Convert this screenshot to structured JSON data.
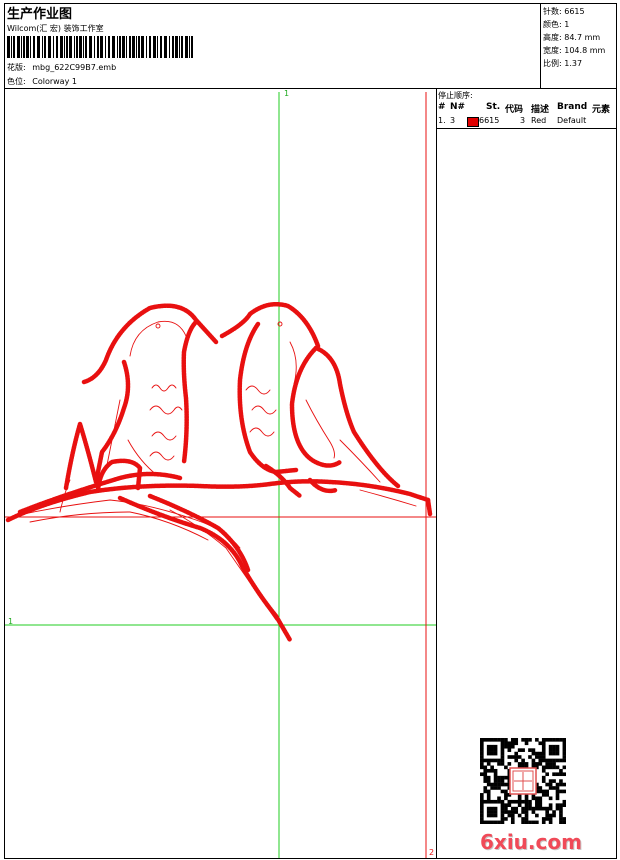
{
  "header": {
    "title": "生产作业图",
    "company": "Wilcom(汇 宏) 装饰工作室",
    "design_file_label": "花版:",
    "design_file": "mbg_622C99B7.emb",
    "colorway_label": "色位:",
    "colorway": "Colorway 1"
  },
  "stats": [
    {
      "label": "针数:",
      "value": "6615"
    },
    {
      "label": "颜色:",
      "value": "1"
    },
    {
      "label": "高度:",
      "value": "84.7 mm"
    },
    {
      "label": "宽度:",
      "value": "104.8 mm"
    },
    {
      "label": "比例:",
      "value": "1.37"
    }
  ],
  "stop_sequence": {
    "title": "停止顺序:",
    "columns": [
      "#",
      "N#",
      "St.",
      "代码",
      "描述",
      "Brand",
      "元素"
    ],
    "rows": [
      {
        "index": "1.",
        "needle": "3",
        "swatch_color": "#e00000",
        "stitches": "6615",
        "code": "3",
        "description": "Red",
        "brand": "Default",
        "element": ""
      }
    ]
  },
  "canvas_markers": {
    "top": "1",
    "left": "1",
    "bottom_right": "2"
  },
  "colors": {
    "thread": "#e81010",
    "guide_green": "#22cc22",
    "guide_red": "#e81010"
  },
  "qr": {
    "seal_icon": "seal-stamp-icon"
  },
  "watermark": "6xiu.com"
}
